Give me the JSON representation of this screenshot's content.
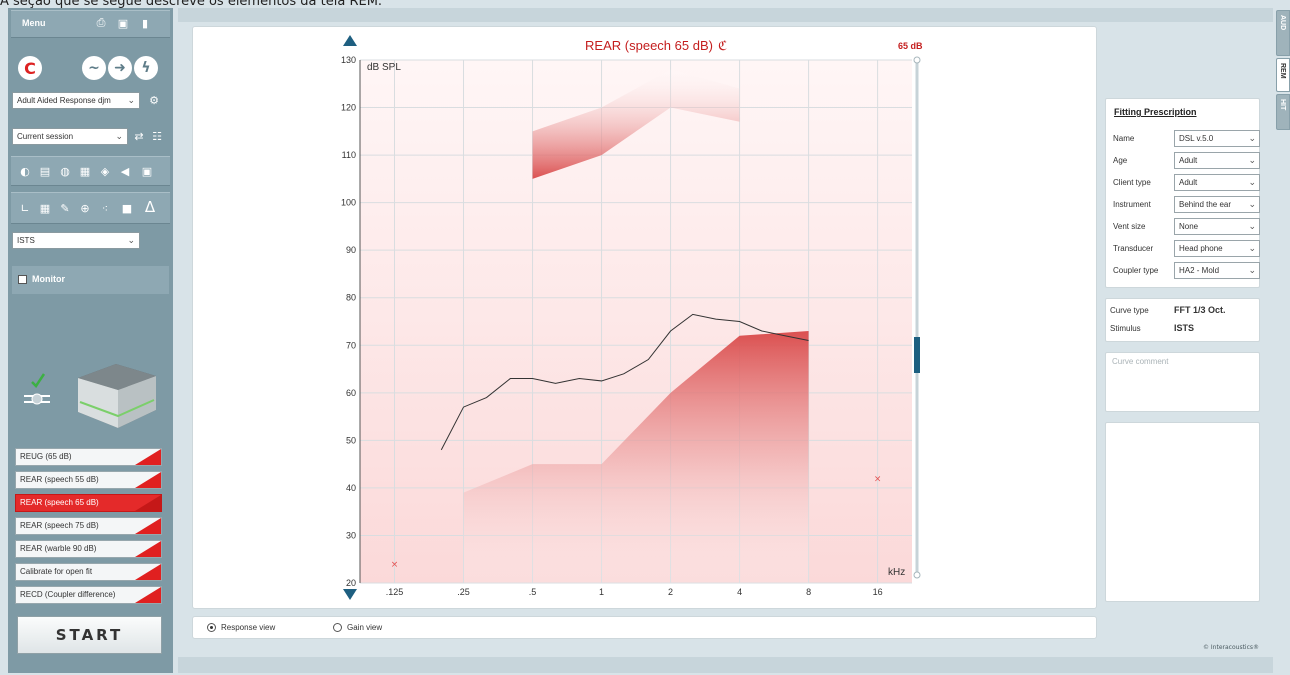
{
  "caption": "A seção que se segue descreve os elementos da tela REM.",
  "left_panel": {
    "menu_label": "Menu",
    "protocol_select": "Adult Aided Response djm",
    "session_select": "Current session",
    "stimulus_select": "ISTS",
    "monitor_label": "Monitor",
    "curve_buttons": [
      {
        "label": "REUG (65 dB)",
        "active": false
      },
      {
        "label": "REAR (speech 55 dB)",
        "active": false
      },
      {
        "label": "REAR (speech 65 dB)",
        "active": true
      },
      {
        "label": "REAR (speech 75 dB)",
        "active": false
      },
      {
        "label": "REAR (warble 90 dB)",
        "active": false
      },
      {
        "label": "Calibrate for open fit",
        "active": false
      },
      {
        "label": "RECD (Coupler difference)",
        "active": false
      }
    ],
    "start_label": "START"
  },
  "view_options": {
    "response_view": "Response view",
    "gain_view": "Gain view",
    "selected": "response_view"
  },
  "fitting_prescription": {
    "title": "Fitting Prescription",
    "rows": [
      {
        "label": "Name",
        "value": "DSL v.5.0"
      },
      {
        "label": "Age",
        "value": "Adult"
      },
      {
        "label": "Client type",
        "value": "Adult"
      },
      {
        "label": "Instrument",
        "value": "Behind the ear"
      },
      {
        "label": "Vent size",
        "value": "None"
      },
      {
        "label": "Transducer",
        "value": "Head phone"
      },
      {
        "label": "Coupler type",
        "value": "HA2 - Mold"
      }
    ]
  },
  "curve_info": {
    "rows": [
      {
        "label": "Curve type",
        "value": "FFT 1/3 Oct."
      },
      {
        "label": "Stimulus",
        "value": "ISTS"
      }
    ]
  },
  "curve_comment_placeholder": "Curve comment",
  "copyright": "© Interacoustics®",
  "side_tabs": [
    "AUD",
    "REM",
    "HIT"
  ],
  "active_side_tab": "REM",
  "colors": {
    "target": "#e07a7a",
    "measured": "#333333",
    "accent": "#d42020"
  },
  "chart_data": {
    "type": "line",
    "title": "REAR (speech 65 dB)",
    "level_label": "65 dB",
    "ylabel": "dB SPL",
    "xlabel": "kHz",
    "ylim": [
      20,
      130
    ],
    "x_scale": "log",
    "xlim": [
      0.0884,
      22.6
    ],
    "xticks": [
      {
        "value": 0.125,
        "label": ".125"
      },
      {
        "value": 0.25,
        "label": ".25"
      },
      {
        "value": 0.5,
        "label": ".5"
      },
      {
        "value": 1,
        "label": "1"
      },
      {
        "value": 2,
        "label": "2"
      },
      {
        "value": 4,
        "label": "4"
      },
      {
        "value": 8,
        "label": "8"
      },
      {
        "value": 16,
        "label": "16"
      }
    ],
    "yticks": [
      20,
      30,
      40,
      50,
      60,
      70,
      80,
      90,
      100,
      110,
      120,
      130
    ],
    "grid": true,
    "series": [
      {
        "kind": "target-area",
        "x": [
          0.25,
          0.5,
          1,
          2,
          4,
          8
        ],
        "y": [
          39,
          45,
          45,
          60,
          72,
          73
        ]
      },
      {
        "kind": "ucl-band",
        "x": [
          0.5,
          1,
          2,
          4
        ],
        "y_low": [
          105,
          110,
          120,
          117
        ],
        "y_high": [
          115,
          120,
          128,
          124
        ]
      },
      {
        "kind": "measured",
        "x": [
          0.2,
          0.25,
          0.315,
          0.4,
          0.5,
          0.63,
          0.8,
          1,
          1.25,
          1.6,
          2,
          2.5,
          3.15,
          4,
          5,
          6.3,
          8
        ],
        "y": [
          48,
          57,
          59,
          63,
          63,
          62,
          63,
          62.5,
          64,
          67,
          73,
          76.5,
          75.5,
          75,
          73,
          72,
          71
        ]
      },
      {
        "kind": "marker",
        "x": [
          0.125,
          16
        ],
        "y": [
          24,
          42
        ]
      }
    ]
  }
}
